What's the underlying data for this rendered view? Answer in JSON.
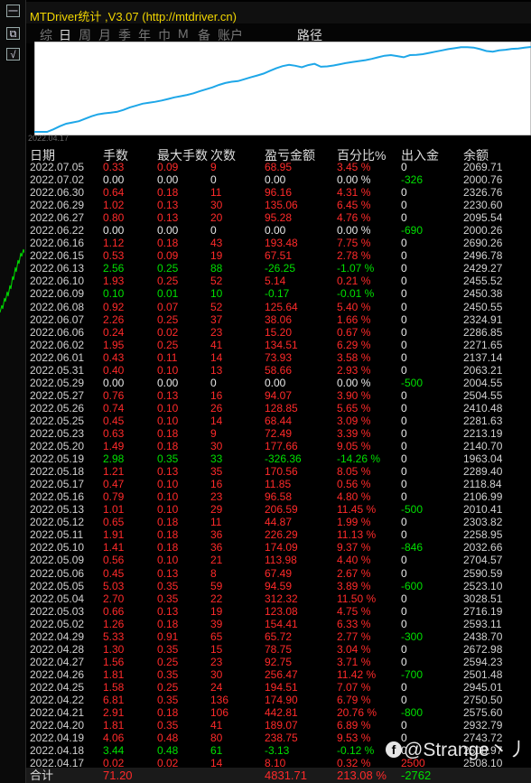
{
  "app": {
    "title": "MTDriver统计 ,V3.07 (http://mtdriver.cn)"
  },
  "left_toolbar": [
    "一",
    "⧉",
    "√"
  ],
  "tabs": [
    "综",
    "日",
    "周",
    "月",
    "季",
    "年",
    "巾",
    "M",
    "备",
    "账户"
  ],
  "route_label": "路径",
  "chart_data": {
    "type": "line",
    "title": "",
    "x_start_label": "2022.04.17",
    "values": [
      0,
      0,
      0,
      80,
      180,
      260,
      300,
      340,
      420,
      500,
      560,
      590,
      610,
      640,
      700,
      780,
      840,
      900,
      930,
      960,
      1000,
      1050,
      1100,
      1140,
      1180,
      1230,
      1300,
      1360,
      1420,
      1500,
      1560,
      1600,
      1620,
      1680,
      1740,
      1800,
      1860,
      1950,
      2030,
      2100,
      2140,
      2110,
      2060,
      2130,
      2170,
      2080,
      2090,
      2120,
      2160,
      2200,
      2230,
      2260,
      2290,
      2330,
      2380,
      2430,
      2450,
      2420,
      2380,
      2450,
      2460,
      2480,
      2520,
      2560,
      2600,
      2640,
      2670,
      2700,
      2700,
      2690,
      2640,
      2580,
      2560,
      2600,
      2620,
      2650,
      2660,
      2690,
      2710
    ]
  },
  "headers": [
    "日期",
    "手数",
    "最大手数",
    "次数",
    "盈亏金额",
    "百分比%",
    "出入金",
    "余额"
  ],
  "rows": [
    [
      "2022.07.05",
      "0.33",
      "0.09",
      "9",
      "68.95",
      "3.45 %",
      "0",
      "2069.71",
      "n",
      "z"
    ],
    [
      "2022.07.02",
      "0.00",
      "0.00",
      "0",
      "0.00",
      "0.00 %",
      "-326",
      "2000.76",
      "z",
      "p"
    ],
    [
      "2022.06.30",
      "0.64",
      "0.18",
      "11",
      "96.16",
      "4.31 %",
      "0",
      "2326.76",
      "n",
      "z"
    ],
    [
      "2022.06.29",
      "1.02",
      "0.13",
      "30",
      "135.06",
      "6.45 %",
      "0",
      "2230.60",
      "n",
      "z"
    ],
    [
      "2022.06.27",
      "0.80",
      "0.13",
      "20",
      "95.28",
      "4.76 %",
      "0",
      "2095.54",
      "n",
      "z"
    ],
    [
      "2022.06.22",
      "0.00",
      "0.00",
      "0",
      "0.00",
      "0.00 %",
      "-690",
      "2000.26",
      "z",
      "p"
    ],
    [
      "2022.06.16",
      "1.12",
      "0.18",
      "43",
      "193.48",
      "7.75 %",
      "0",
      "2690.26",
      "n",
      "z"
    ],
    [
      "2022.06.15",
      "0.53",
      "0.09",
      "19",
      "67.51",
      "2.78 %",
      "0",
      "2496.78",
      "n",
      "z"
    ],
    [
      "2022.06.13",
      "2.56",
      "0.25",
      "88",
      "-26.25",
      "-1.07 %",
      "0",
      "2429.27",
      "p",
      "z"
    ],
    [
      "2022.06.10",
      "1.93",
      "0.25",
      "52",
      "5.14",
      "0.21 %",
      "0",
      "2455.52",
      "n",
      "z"
    ],
    [
      "2022.06.09",
      "0.10",
      "0.01",
      "10",
      "-0.17",
      "-0.01 %",
      "0",
      "2450.38",
      "p",
      "z"
    ],
    [
      "2022.06.08",
      "0.92",
      "0.07",
      "52",
      "125.64",
      "5.40 %",
      "0",
      "2450.55",
      "n",
      "z"
    ],
    [
      "2022.06.07",
      "2.26",
      "0.25",
      "37",
      "38.06",
      "1.66 %",
      "0",
      "2324.91",
      "n",
      "z"
    ],
    [
      "2022.06.06",
      "0.24",
      "0.02",
      "23",
      "15.20",
      "0.67 %",
      "0",
      "2286.85",
      "n",
      "z"
    ],
    [
      "2022.06.02",
      "1.95",
      "0.25",
      "41",
      "134.51",
      "6.29 %",
      "0",
      "2271.65",
      "n",
      "z"
    ],
    [
      "2022.06.01",
      "0.43",
      "0.11",
      "14",
      "73.93",
      "3.58 %",
      "0",
      "2137.14",
      "n",
      "z"
    ],
    [
      "2022.05.31",
      "0.40",
      "0.10",
      "13",
      "58.66",
      "2.93 %",
      "0",
      "2063.21",
      "n",
      "z"
    ],
    [
      "2022.05.29",
      "0.00",
      "0.00",
      "0",
      "0.00",
      "0.00 %",
      "-500",
      "2004.55",
      "z",
      "p"
    ],
    [
      "2022.05.27",
      "0.76",
      "0.13",
      "16",
      "94.07",
      "3.90 %",
      "0",
      "2504.55",
      "n",
      "z"
    ],
    [
      "2022.05.26",
      "0.74",
      "0.10",
      "26",
      "128.85",
      "5.65 %",
      "0",
      "2410.48",
      "n",
      "z"
    ],
    [
      "2022.05.25",
      "0.45",
      "0.10",
      "14",
      "68.44",
      "3.09 %",
      "0",
      "2281.63",
      "n",
      "z"
    ],
    [
      "2022.05.23",
      "0.63",
      "0.18",
      "9",
      "72.49",
      "3.39 %",
      "0",
      "2213.19",
      "n",
      "z"
    ],
    [
      "2022.05.20",
      "1.49",
      "0.18",
      "30",
      "177.66",
      "9.05 %",
      "0",
      "2140.70",
      "n",
      "z"
    ],
    [
      "2022.05.19",
      "2.98",
      "0.35",
      "33",
      "-326.36",
      "-14.26 %",
      "0",
      "1963.04",
      "p",
      "z"
    ],
    [
      "2022.05.18",
      "1.21",
      "0.13",
      "35",
      "170.56",
      "8.05 %",
      "0",
      "2289.40",
      "n",
      "z"
    ],
    [
      "2022.05.17",
      "0.47",
      "0.10",
      "16",
      "11.85",
      "0.56 %",
      "0",
      "2118.84",
      "n",
      "z"
    ],
    [
      "2022.05.16",
      "0.79",
      "0.10",
      "23",
      "96.58",
      "4.80 %",
      "0",
      "2106.99",
      "n",
      "z"
    ],
    [
      "2022.05.13",
      "1.01",
      "0.10",
      "29",
      "206.59",
      "11.45 %",
      "-500",
      "2010.41",
      "n",
      "p"
    ],
    [
      "2022.05.12",
      "0.65",
      "0.18",
      "11",
      "44.87",
      "1.99 %",
      "0",
      "2303.82",
      "n",
      "z"
    ],
    [
      "2022.05.11",
      "1.91",
      "0.18",
      "36",
      "226.29",
      "11.13 %",
      "0",
      "2258.95",
      "n",
      "z"
    ],
    [
      "2022.05.10",
      "1.41",
      "0.18",
      "36",
      "174.09",
      "9.37 %",
      "-846",
      "2032.66",
      "n",
      "p"
    ],
    [
      "2022.05.09",
      "0.56",
      "0.10",
      "21",
      "113.98",
      "4.40 %",
      "0",
      "2704.57",
      "n",
      "z"
    ],
    [
      "2022.05.06",
      "0.45",
      "0.13",
      "8",
      "67.49",
      "2.67 %",
      "0",
      "2590.59",
      "n",
      "z"
    ],
    [
      "2022.05.05",
      "5.03",
      "0.35",
      "59",
      "94.59",
      "3.89 %",
      "-600",
      "2523.10",
      "n",
      "p"
    ],
    [
      "2022.05.04",
      "2.70",
      "0.35",
      "22",
      "312.32",
      "11.50 %",
      "0",
      "3028.51",
      "n",
      "z"
    ],
    [
      "2022.05.03",
      "0.66",
      "0.13",
      "19",
      "123.08",
      "4.75 %",
      "0",
      "2716.19",
      "n",
      "z"
    ],
    [
      "2022.05.02",
      "1.26",
      "0.18",
      "39",
      "154.41",
      "6.33 %",
      "0",
      "2593.11",
      "n",
      "z"
    ],
    [
      "2022.04.29",
      "5.33",
      "0.91",
      "65",
      "65.72",
      "2.77 %",
      "-300",
      "2438.70",
      "n",
      "p"
    ],
    [
      "2022.04.28",
      "1.30",
      "0.35",
      "15",
      "78.75",
      "3.04 %",
      "0",
      "2672.98",
      "n",
      "z"
    ],
    [
      "2022.04.27",
      "1.56",
      "0.25",
      "23",
      "92.75",
      "3.71 %",
      "0",
      "2594.23",
      "n",
      "z"
    ],
    [
      "2022.04.26",
      "1.81",
      "0.35",
      "30",
      "256.47",
      "11.42 %",
      "-700",
      "2501.48",
      "n",
      "p"
    ],
    [
      "2022.04.25",
      "1.58",
      "0.25",
      "24",
      "194.51",
      "7.07 %",
      "0",
      "2945.01",
      "n",
      "z"
    ],
    [
      "2022.04.22",
      "6.81",
      "0.35",
      "136",
      "174.90",
      "6.79 %",
      "0",
      "2750.50",
      "n",
      "z"
    ],
    [
      "2022.04.21",
      "2.91",
      "0.18",
      "106",
      "442.81",
      "20.76 %",
      "-800",
      "2575.60",
      "n",
      "p"
    ],
    [
      "2022.04.20",
      "1.81",
      "0.35",
      "41",
      "189.07",
      "6.89 %",
      "0",
      "2932.79",
      "n",
      "z"
    ],
    [
      "2022.04.19",
      "4.06",
      "0.48",
      "80",
      "238.75",
      "9.53 %",
      "0",
      "2743.72",
      "n",
      "z"
    ],
    [
      "2022.04.18",
      "3.44",
      "0.48",
      "61",
      "-3.13",
      "-0.12 %",
      "0",
      "2508.97",
      "p",
      "z"
    ],
    [
      "2022.04.17",
      "0.02",
      "0.02",
      "14",
      "8.10",
      "0.32 %",
      "2500",
      "2508.10",
      "n",
      "n"
    ]
  ],
  "total": {
    "label": "合计",
    "lots": "71.20",
    "profit": "4831.71",
    "pct": "213.08 %",
    "inout": "-2762"
  },
  "watermark": "@Strange丶丿",
  "colors": {
    "profit": "#ff2a2a",
    "loss": "#00e000",
    "line": "#1ea7e8",
    "title": "#f2d600"
  }
}
